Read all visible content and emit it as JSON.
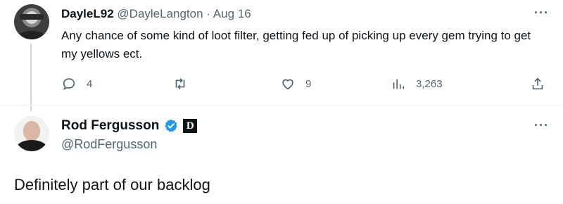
{
  "reply": {
    "display_name": "DayleL92",
    "handle": "@DayleLangton",
    "separator": "·",
    "date": "Aug 16",
    "text": "Any chance of some kind of loot filter, getting fed up of picking up every gem trying to get my yellows ect.",
    "more_label": "···",
    "actions": {
      "reply_count": "4",
      "retweet_count": "",
      "like_count": "9",
      "view_count": "3,263"
    }
  },
  "main_tweet": {
    "display_name": "Rod Fergusson",
    "badge_letter": "D",
    "handle": "@RodFergusson",
    "text": "Definitely part of our backlog",
    "more_label": "···"
  },
  "colors": {
    "text": "#0f1419",
    "muted": "#536471",
    "verified": "#1d9bf0",
    "thread_line": "#cfd9de"
  },
  "icons": {
    "reply": "comment-icon",
    "retweet": "retweet-icon",
    "like": "heart-icon",
    "views": "views-bar-icon",
    "share": "share-icon",
    "verified": "verified-badge-icon"
  }
}
